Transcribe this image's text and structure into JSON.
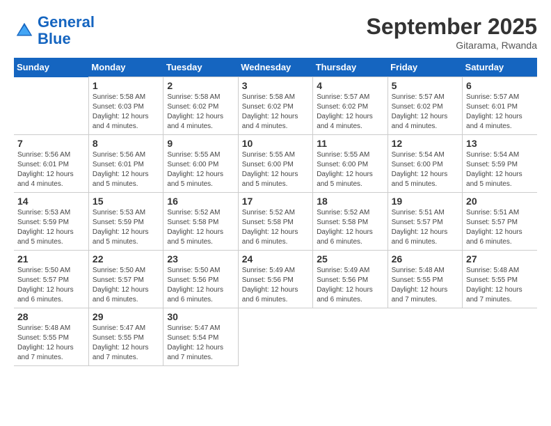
{
  "header": {
    "logo_line1": "General",
    "logo_line2": "Blue",
    "month_title": "September 2025",
    "subtitle": "Gitarama, Rwanda"
  },
  "weekdays": [
    "Sunday",
    "Monday",
    "Tuesday",
    "Wednesday",
    "Thursday",
    "Friday",
    "Saturday"
  ],
  "weeks": [
    [
      {
        "day": "",
        "info": ""
      },
      {
        "day": "1",
        "info": "Sunrise: 5:58 AM\nSunset: 6:03 PM\nDaylight: 12 hours\nand 4 minutes."
      },
      {
        "day": "2",
        "info": "Sunrise: 5:58 AM\nSunset: 6:02 PM\nDaylight: 12 hours\nand 4 minutes."
      },
      {
        "day": "3",
        "info": "Sunrise: 5:58 AM\nSunset: 6:02 PM\nDaylight: 12 hours\nand 4 minutes."
      },
      {
        "day": "4",
        "info": "Sunrise: 5:57 AM\nSunset: 6:02 PM\nDaylight: 12 hours\nand 4 minutes."
      },
      {
        "day": "5",
        "info": "Sunrise: 5:57 AM\nSunset: 6:02 PM\nDaylight: 12 hours\nand 4 minutes."
      },
      {
        "day": "6",
        "info": "Sunrise: 5:57 AM\nSunset: 6:01 PM\nDaylight: 12 hours\nand 4 minutes."
      }
    ],
    [
      {
        "day": "7",
        "info": "Sunrise: 5:56 AM\nSunset: 6:01 PM\nDaylight: 12 hours\nand 4 minutes."
      },
      {
        "day": "8",
        "info": "Sunrise: 5:56 AM\nSunset: 6:01 PM\nDaylight: 12 hours\nand 5 minutes."
      },
      {
        "day": "9",
        "info": "Sunrise: 5:55 AM\nSunset: 6:00 PM\nDaylight: 12 hours\nand 5 minutes."
      },
      {
        "day": "10",
        "info": "Sunrise: 5:55 AM\nSunset: 6:00 PM\nDaylight: 12 hours\nand 5 minutes."
      },
      {
        "day": "11",
        "info": "Sunrise: 5:55 AM\nSunset: 6:00 PM\nDaylight: 12 hours\nand 5 minutes."
      },
      {
        "day": "12",
        "info": "Sunrise: 5:54 AM\nSunset: 6:00 PM\nDaylight: 12 hours\nand 5 minutes."
      },
      {
        "day": "13",
        "info": "Sunrise: 5:54 AM\nSunset: 5:59 PM\nDaylight: 12 hours\nand 5 minutes."
      }
    ],
    [
      {
        "day": "14",
        "info": "Sunrise: 5:53 AM\nSunset: 5:59 PM\nDaylight: 12 hours\nand 5 minutes."
      },
      {
        "day": "15",
        "info": "Sunrise: 5:53 AM\nSunset: 5:59 PM\nDaylight: 12 hours\nand 5 minutes."
      },
      {
        "day": "16",
        "info": "Sunrise: 5:52 AM\nSunset: 5:58 PM\nDaylight: 12 hours\nand 5 minutes."
      },
      {
        "day": "17",
        "info": "Sunrise: 5:52 AM\nSunset: 5:58 PM\nDaylight: 12 hours\nand 6 minutes."
      },
      {
        "day": "18",
        "info": "Sunrise: 5:52 AM\nSunset: 5:58 PM\nDaylight: 12 hours\nand 6 minutes."
      },
      {
        "day": "19",
        "info": "Sunrise: 5:51 AM\nSunset: 5:57 PM\nDaylight: 12 hours\nand 6 minutes."
      },
      {
        "day": "20",
        "info": "Sunrise: 5:51 AM\nSunset: 5:57 PM\nDaylight: 12 hours\nand 6 minutes."
      }
    ],
    [
      {
        "day": "21",
        "info": "Sunrise: 5:50 AM\nSunset: 5:57 PM\nDaylight: 12 hours\nand 6 minutes."
      },
      {
        "day": "22",
        "info": "Sunrise: 5:50 AM\nSunset: 5:57 PM\nDaylight: 12 hours\nand 6 minutes."
      },
      {
        "day": "23",
        "info": "Sunrise: 5:50 AM\nSunset: 5:56 PM\nDaylight: 12 hours\nand 6 minutes."
      },
      {
        "day": "24",
        "info": "Sunrise: 5:49 AM\nSunset: 5:56 PM\nDaylight: 12 hours\nand 6 minutes."
      },
      {
        "day": "25",
        "info": "Sunrise: 5:49 AM\nSunset: 5:56 PM\nDaylight: 12 hours\nand 6 minutes."
      },
      {
        "day": "26",
        "info": "Sunrise: 5:48 AM\nSunset: 5:55 PM\nDaylight: 12 hours\nand 7 minutes."
      },
      {
        "day": "27",
        "info": "Sunrise: 5:48 AM\nSunset: 5:55 PM\nDaylight: 12 hours\nand 7 minutes."
      }
    ],
    [
      {
        "day": "28",
        "info": "Sunrise: 5:48 AM\nSunset: 5:55 PM\nDaylight: 12 hours\nand 7 minutes."
      },
      {
        "day": "29",
        "info": "Sunrise: 5:47 AM\nSunset: 5:55 PM\nDaylight: 12 hours\nand 7 minutes."
      },
      {
        "day": "30",
        "info": "Sunrise: 5:47 AM\nSunset: 5:54 PM\nDaylight: 12 hours\nand 7 minutes."
      },
      {
        "day": "",
        "info": ""
      },
      {
        "day": "",
        "info": ""
      },
      {
        "day": "",
        "info": ""
      },
      {
        "day": "",
        "info": ""
      }
    ]
  ]
}
